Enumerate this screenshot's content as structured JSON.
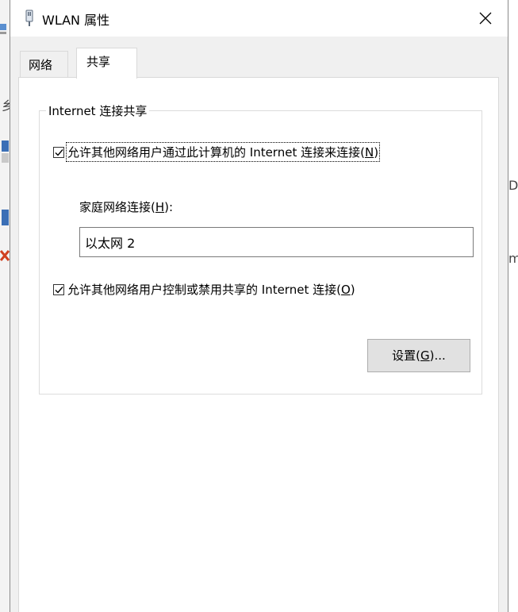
{
  "window": {
    "title": "WLAN 属性",
    "close_glyph": "✕"
  },
  "background_fragments": {
    "left_1": "乡",
    "right_1": "D",
    "right_2": "m"
  },
  "tabs": [
    {
      "label": "网络",
      "active": false
    },
    {
      "label": "共享",
      "active": true
    }
  ],
  "sharing": {
    "group_title": "Internet 连接共享",
    "allow_connect": {
      "checked": true,
      "label_pre": "允许其他网络用户通过此计算机的 Internet 连接来连接(",
      "accel": "N",
      "label_post": ")"
    },
    "home_network": {
      "label_pre": "家庭网络连接(",
      "accel": "H",
      "label_post": "):",
      "value": "以太网 2"
    },
    "allow_control": {
      "checked": true,
      "label_pre": "允许其他网络用户控制或禁用共享的 Internet 连接(",
      "accel": "O",
      "label_post": ")"
    },
    "settings_button": {
      "label_pre": "设置(",
      "accel": "G",
      "label_post": ")..."
    }
  },
  "colors": {
    "window_bg": "#f0f0f0",
    "panel_bg": "#ffffff",
    "button_bg": "#e1e1e1",
    "group_border": "#dcdcdc"
  },
  "icons": {
    "title": "network-adapter-icon",
    "close": "close-icon",
    "check": "checkmark-icon"
  }
}
